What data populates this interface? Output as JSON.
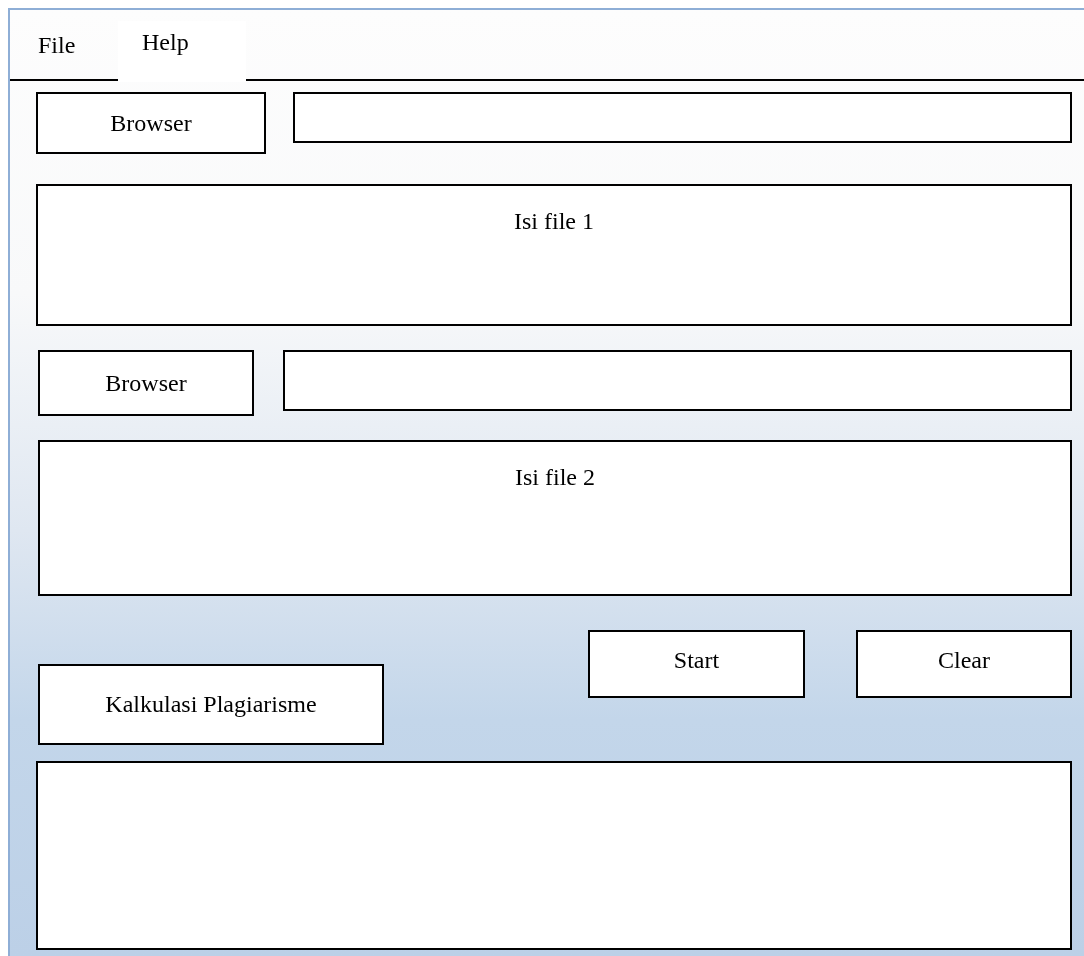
{
  "menu": [
    {
      "label": "File"
    },
    {
      "label": "Help"
    }
  ],
  "files": [
    {
      "browse_button": "Browser",
      "content_label": "Isi file 1"
    },
    {
      "browse_button": "Browser",
      "content_label": "Isi file 2"
    }
  ],
  "actions": {
    "calculate": "Kalkulasi Plagiarisme",
    "start": "Start",
    "clear": "Clear"
  }
}
